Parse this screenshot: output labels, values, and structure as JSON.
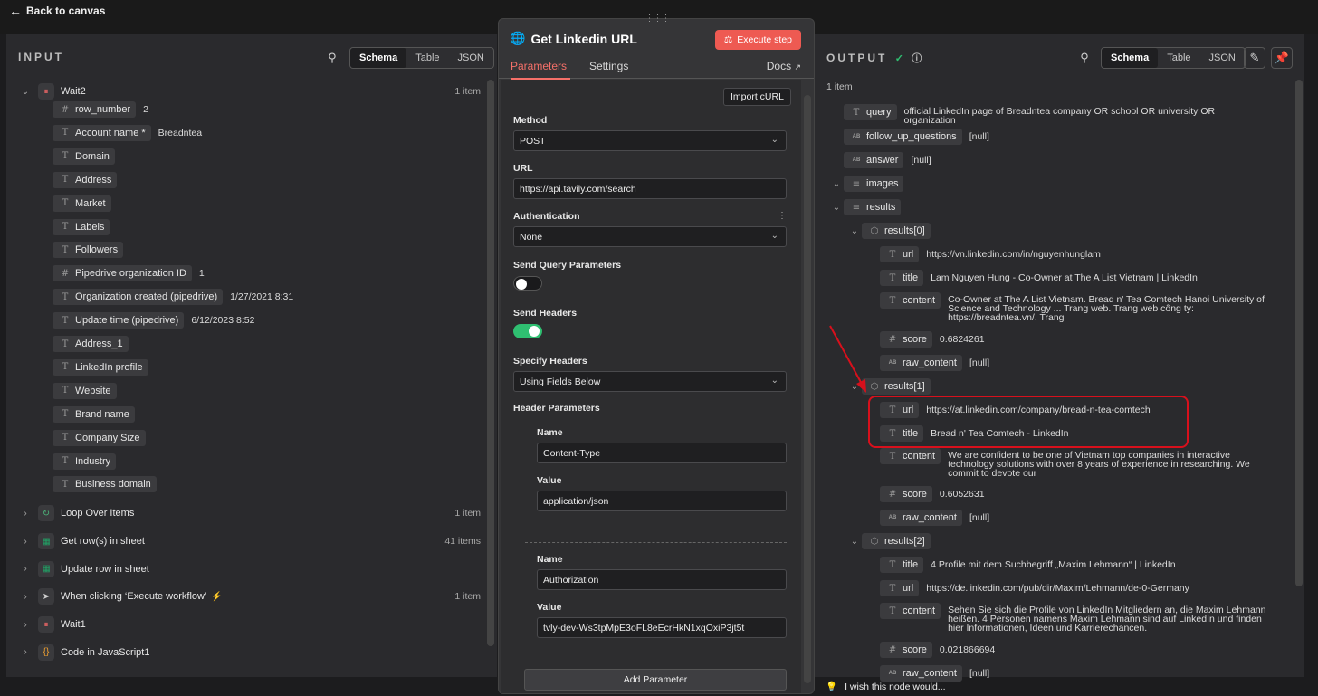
{
  "topbar": {
    "back_label": "Back to canvas"
  },
  "input": {
    "title": "INPUT",
    "view_tabs": [
      "Schema",
      "Table",
      "JSON"
    ],
    "active_tab": "Schema",
    "nodes": [
      {
        "name": "Wait2",
        "count": "1 item",
        "expanded": true,
        "icon": "pause-icon",
        "color": "#ff6b6b"
      },
      {
        "name": "Loop Over Items",
        "count": "1 item",
        "icon": "loop-icon",
        "color": "#4caf78"
      },
      {
        "name": "Get row(s) in sheet",
        "count": "41 items",
        "icon": "sheets-icon",
        "color": "#21a366"
      },
      {
        "name": "Update row in sheet",
        "count": "",
        "icon": "sheets-icon",
        "color": "#21a366"
      },
      {
        "name": "When clicking ‘Execute workflow’",
        "count": "1 item",
        "icon": "cursor-icon",
        "color": "#cfcfcf"
      },
      {
        "name": "Wait1",
        "count": "",
        "icon": "pause-icon",
        "color": "#ff6b6b"
      },
      {
        "name": "Code in JavaScript1",
        "count": "",
        "icon": "code-icon",
        "color": "#f0a030"
      }
    ],
    "fields": [
      {
        "type": "#",
        "name": "row_number",
        "value": "2"
      },
      {
        "type": "T",
        "name": "Account name *",
        "value": "Breadntea"
      },
      {
        "type": "T",
        "name": "Domain",
        "value": ""
      },
      {
        "type": "T",
        "name": "Address",
        "value": ""
      },
      {
        "type": "T",
        "name": "Market",
        "value": ""
      },
      {
        "type": "T",
        "name": "Labels",
        "value": ""
      },
      {
        "type": "T",
        "name": "Followers",
        "value": ""
      },
      {
        "type": "#",
        "name": "Pipedrive organization ID",
        "value": "1"
      },
      {
        "type": "T",
        "name": "Organization created (pipedrive)",
        "value": "1/27/2021 8:31"
      },
      {
        "type": "T",
        "name": "Update time (pipedrive)",
        "value": "6/12/2023 8:52"
      },
      {
        "type": "T",
        "name": "Address_1",
        "value": ""
      },
      {
        "type": "T",
        "name": "LinkedIn profile",
        "value": ""
      },
      {
        "type": "T",
        "name": "Website",
        "value": ""
      },
      {
        "type": "T",
        "name": "Brand name",
        "value": ""
      },
      {
        "type": "T",
        "name": "Company Size",
        "value": ""
      },
      {
        "type": "T",
        "name": "Industry",
        "value": ""
      },
      {
        "type": "T",
        "name": "Business domain",
        "value": ""
      }
    ]
  },
  "modal": {
    "title": "Get Linkedin URL",
    "execute_label": "Execute step",
    "tabs": {
      "parameters": "Parameters",
      "settings": "Settings",
      "docs": "Docs"
    },
    "import_curl": "Import cURL",
    "method_label": "Method",
    "method_value": "POST",
    "url_label": "URL",
    "url_value": "https://api.tavily.com/search",
    "auth_label": "Authentication",
    "auth_value": "None",
    "send_query_label": "Send Query Parameters",
    "send_query_on": false,
    "send_headers_label": "Send Headers",
    "send_headers_on": true,
    "specify_headers_label": "Specify Headers",
    "specify_headers_value": "Using Fields Below",
    "header_params_label": "Header Parameters",
    "headers": [
      {
        "name_label": "Name",
        "name": "Content-Type",
        "value_label": "Value",
        "value": "application/json"
      },
      {
        "name_label": "Name",
        "name": "Authorization",
        "value_label": "Value",
        "value": "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"
      }
    ],
    "add_parameter": "Add Parameter"
  },
  "output": {
    "title": "OUTPUT",
    "view_tabs": [
      "Schema",
      "Table",
      "JSON"
    ],
    "active_tab": "Schema",
    "item_count": "1 item",
    "rows": [
      {
        "type": "T",
        "key": "query",
        "value": "official LinkedIn page of Breadntea company OR school OR university OR organization",
        "indent": 0
      },
      {
        "type": "AB",
        "key": "follow_up_questions",
        "value": "[null]",
        "indent": 0
      },
      {
        "type": "AB",
        "key": "answer",
        "value": "[null]",
        "indent": 0
      },
      {
        "type": "list",
        "key": "images",
        "value": "",
        "indent": 0,
        "chev": true
      },
      {
        "type": "list",
        "key": "results",
        "value": "",
        "indent": 0,
        "chev": true
      },
      {
        "type": "obj",
        "key": "results[0]",
        "value": "",
        "indent": 1,
        "chev": true
      },
      {
        "type": "T",
        "key": "url",
        "value": "https://vn.linkedin.com/in/nguyenhunglam",
        "indent": 2
      },
      {
        "type": "T",
        "key": "title",
        "value": "Lam Nguyen Hung - Co-Owner at The A List Vietnam | LinkedIn",
        "indent": 2
      },
      {
        "type": "T",
        "key": "content",
        "value": "Co-Owner at The A List Vietnam. Bread n' Tea Comtech Hanoi University of Science and Technology ... Trang web. Trang web công ty: https://breadntea.vn/. Trang",
        "indent": 2
      },
      {
        "type": "#",
        "key": "score",
        "value": "0.6824261",
        "indent": 2
      },
      {
        "type": "AB",
        "key": "raw_content",
        "value": "[null]",
        "indent": 2
      },
      {
        "type": "obj",
        "key": "results[1]",
        "value": "",
        "indent": 1,
        "chev": true
      },
      {
        "type": "T",
        "key": "url",
        "value": "https://at.linkedin.com/company/bread-n-tea-comtech",
        "indent": 2
      },
      {
        "type": "T",
        "key": "title",
        "value": "Bread n' Tea Comtech - LinkedIn",
        "indent": 2
      },
      {
        "type": "T",
        "key": "content",
        "value": "We are confident to be one of Vietnam top companies in interactive technology solutions with over 8 years of experience in researching. We commit to devote our",
        "indent": 2
      },
      {
        "type": "#",
        "key": "score",
        "value": "0.6052631",
        "indent": 2
      },
      {
        "type": "AB",
        "key": "raw_content",
        "value": "[null]",
        "indent": 2
      },
      {
        "type": "obj",
        "key": "results[2]",
        "value": "",
        "indent": 1,
        "chev": true
      },
      {
        "type": "T",
        "key": "title",
        "value": "4 Profile mit dem Suchbegriff „Maxim Lehmann“ | LinkedIn",
        "indent": 2
      },
      {
        "type": "T",
        "key": "url",
        "value": "https://de.linkedin.com/pub/dir/Maxim/Lehmann/de-0-Germany",
        "indent": 2
      },
      {
        "type": "T",
        "key": "content",
        "value": "Sehen Sie sich die Profile von LinkedIn Mitgliedern an, die Maxim Lehmann heißen. 4 Personen namens Maxim Lehmann sind auf LinkedIn und finden hier Informationen, Ideen und Karrierechancen.",
        "indent": 2
      },
      {
        "type": "#",
        "key": "score",
        "value": "0.021866694",
        "indent": 2
      },
      {
        "type": "AB",
        "key": "raw_content",
        "value": "[null]",
        "indent": 2
      }
    ],
    "feedback": "I wish this node would..."
  },
  "colors": {
    "accent": "#f57069",
    "toggle_on": "#2fbf71",
    "highlight": "#d8101c"
  }
}
